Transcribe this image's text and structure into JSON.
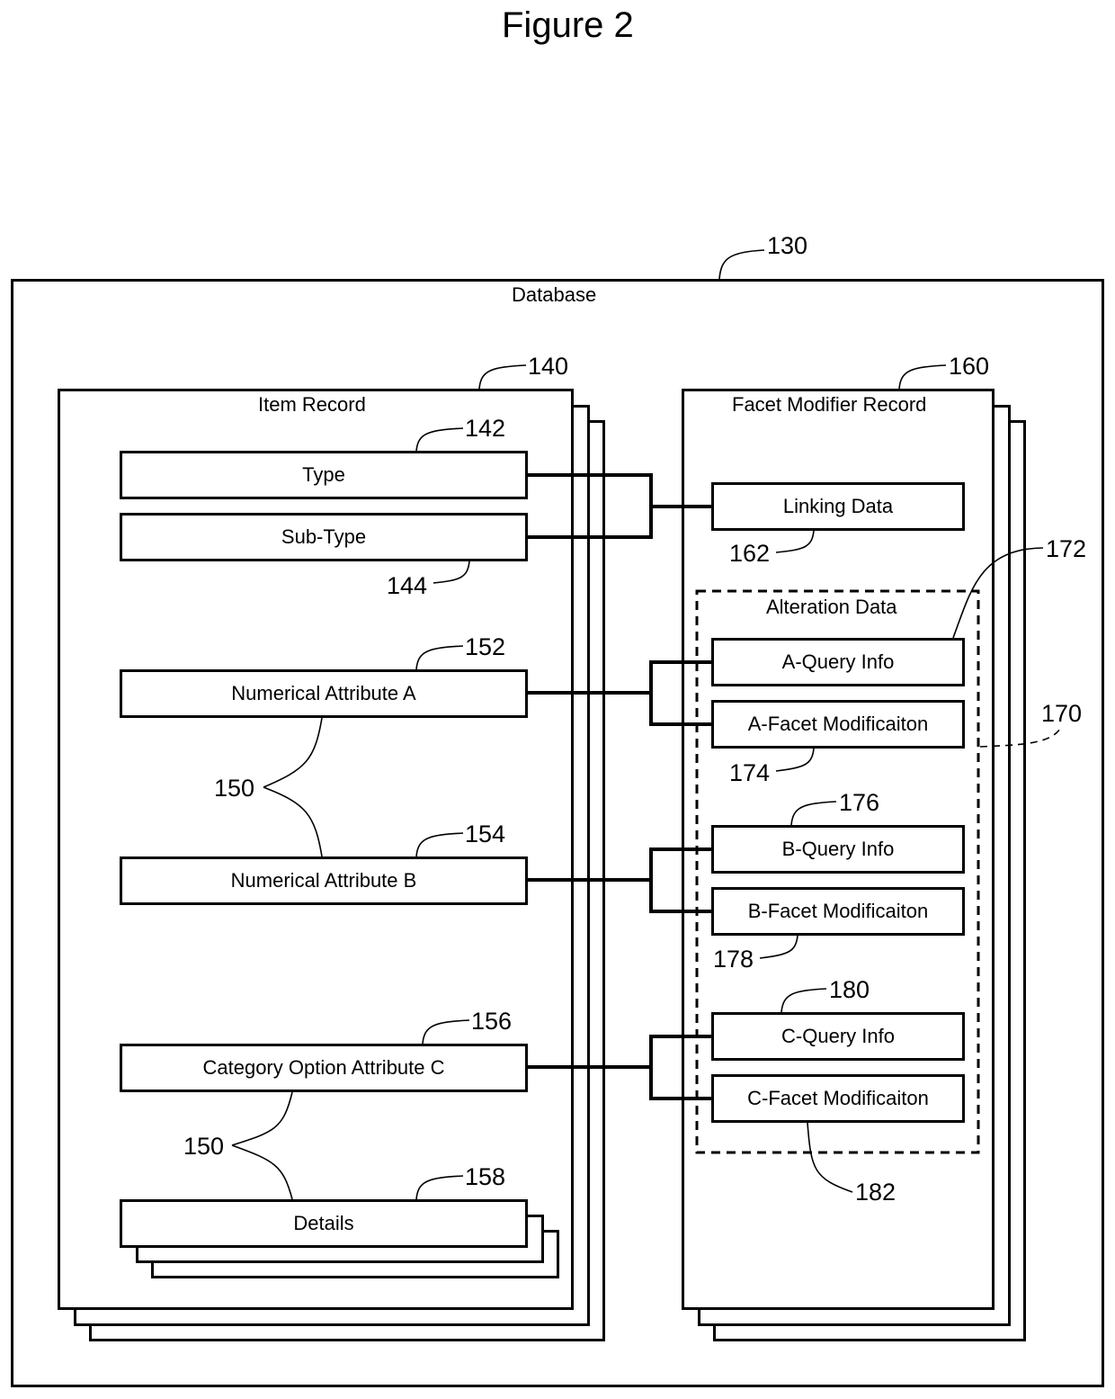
{
  "figure_title": "Figure 2",
  "database": {
    "label": "Database",
    "ref": "130"
  },
  "item_record": {
    "label": "Item Record",
    "ref": "140",
    "fields": [
      {
        "label": "Type",
        "ref": "142"
      },
      {
        "label": "Sub-Type",
        "ref": "144"
      },
      {
        "label": "Numerical Attribute A",
        "ref": "152"
      },
      {
        "label": "Numerical Attribute B",
        "ref": "154"
      },
      {
        "label": "Category Option Attribute C",
        "ref": "156"
      },
      {
        "label": "Details",
        "ref": "158"
      }
    ],
    "group_refs": [
      "150",
      "150"
    ]
  },
  "facet_modifier_record": {
    "label": "Facet Modifier Record",
    "ref": "160",
    "linking_data": {
      "label": "Linking Data",
      "ref": "162"
    },
    "alteration_data": {
      "label": "Alteration Data",
      "ref": "170",
      "fields": [
        {
          "label": "A-Query Info",
          "ref": "172"
        },
        {
          "label": "A-Facet Modificaiton",
          "ref": "174"
        },
        {
          "label": "B-Query Info",
          "ref": "176"
        },
        {
          "label": "B-Facet Modificaiton",
          "ref": "178"
        },
        {
          "label": "C-Query Info",
          "ref": "180"
        },
        {
          "label": "C-Facet Modificaiton",
          "ref": "182"
        }
      ]
    }
  }
}
